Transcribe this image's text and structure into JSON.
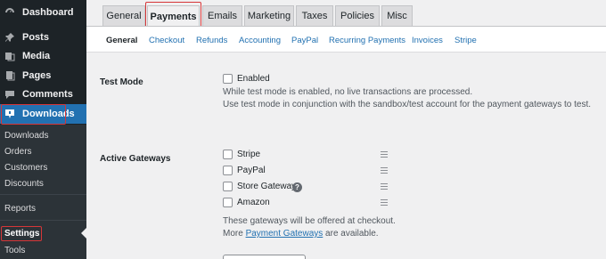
{
  "sidebar": {
    "menu": [
      {
        "label": "Dashboard",
        "icon": "dashboard-icon"
      },
      {
        "label": "Posts",
        "icon": "pin-icon"
      },
      {
        "label": "Media",
        "icon": "media-icon"
      },
      {
        "label": "Pages",
        "icon": "pages-icon"
      },
      {
        "label": "Comments",
        "icon": "comments-icon"
      },
      {
        "label": "Downloads",
        "icon": "download-icon"
      }
    ],
    "submenu": [
      "Downloads",
      "Orders",
      "Customers",
      "Discounts",
      "Reports",
      "Settings",
      "Tools"
    ]
  },
  "tabs": [
    "General",
    "Payments",
    "Emails",
    "Marketing",
    "Taxes",
    "Policies",
    "Misc"
  ],
  "subtabs": [
    "General",
    "Checkout",
    "Refunds",
    "Accounting",
    "PayPal",
    "Recurring Payments",
    "Invoices",
    "Stripe"
  ],
  "test_mode": {
    "label": "Test Mode",
    "checkbox_label": "Enabled",
    "desc1": "While test mode is enabled, no live transactions are processed.",
    "desc2": "Use test mode in conjunction with the sandbox/test account for the payment gateways to test."
  },
  "gateways": {
    "label": "Active Gateways",
    "items": [
      "Stripe",
      "PayPal",
      "Store Gateway",
      "Amazon"
    ],
    "help_glyph": "?",
    "desc1": "These gateways will be offered at checkout.",
    "desc2_pre": "More ",
    "desc2_link": "Payment Gateways",
    "desc2_post": " are available."
  },
  "colors": {
    "sidebar": "#1d2327",
    "accent": "#2271b1",
    "highlight": "#d63638"
  }
}
